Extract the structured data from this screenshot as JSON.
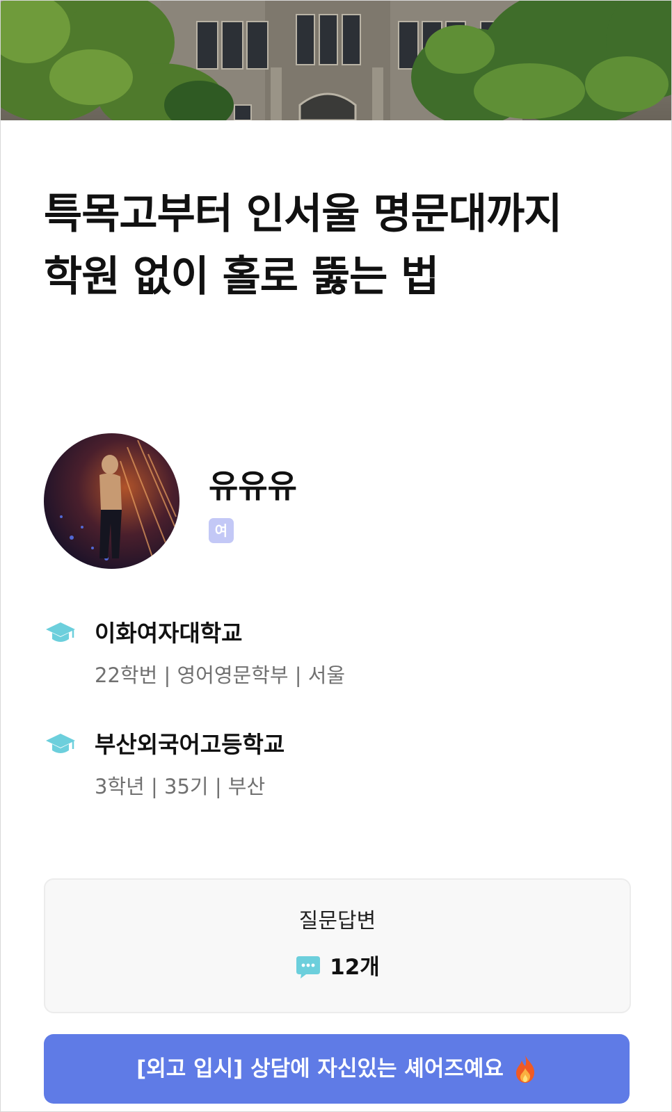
{
  "post": {
    "title_line1": "특목고부터 인서울 명문대까지",
    "title_line2": "학원 없이 홀로 뚫는 법"
  },
  "profile": {
    "name": "유유유",
    "gender": "여"
  },
  "education": [
    {
      "school": "이화여자대학교",
      "detail": "22학번 | 영어영문학부 | 서울",
      "icon": "graduation-cap-icon"
    },
    {
      "school": "부산외국어고등학교",
      "detail": "3학년 | 35기 | 부산",
      "icon": "graduation-cap-icon"
    }
  ],
  "qa": {
    "title": "질문답변",
    "count": "12개",
    "icon": "chat-bubble-icon"
  },
  "cta": {
    "label": "[외고 입시] 상담에 자신있는 셰어즈예요",
    "icon": "fire-icon"
  },
  "colors": {
    "accent": "#5f7be6",
    "badge": "#c3c8f6",
    "icon_teal": "#6ccfdc",
    "muted_text": "#707070"
  }
}
